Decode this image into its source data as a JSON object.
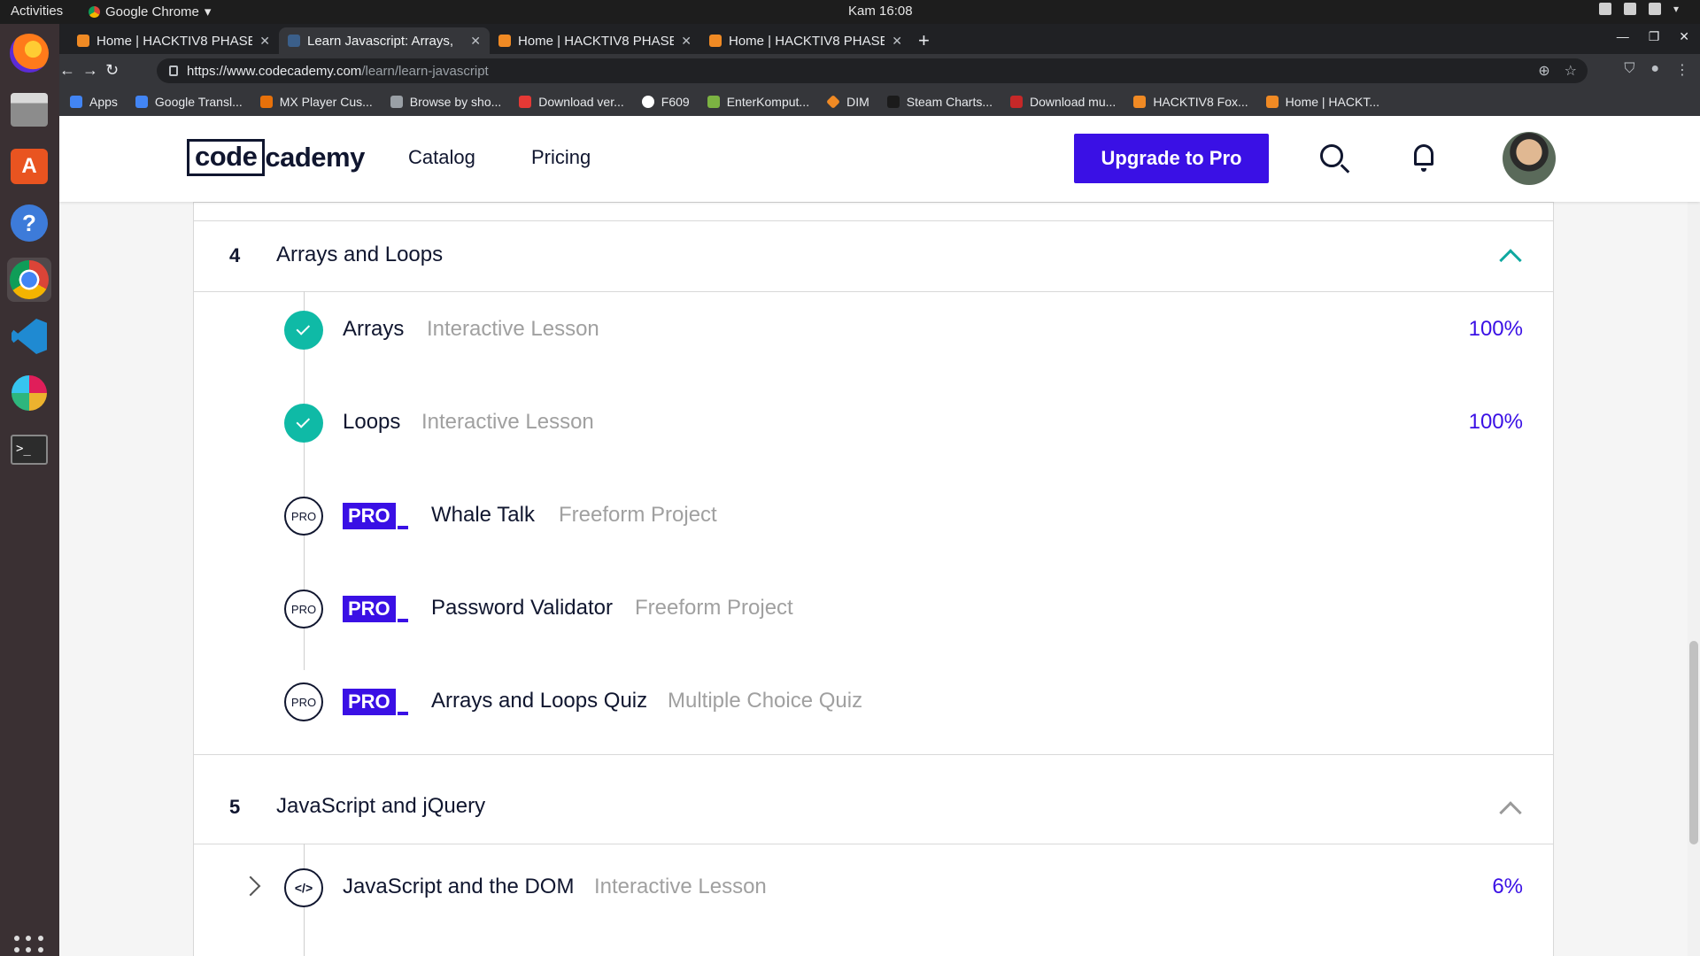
{
  "os": {
    "activities": "Activities",
    "app_name": "Google Chrome",
    "clock": "Kam 16:08"
  },
  "browser": {
    "tabs": [
      {
        "title": "Home | HACKTIV8 PHASE",
        "active": false
      },
      {
        "title": "Learn Javascript: Arrays, ",
        "active": true
      },
      {
        "title": "Home | HACKTIV8 PHASE",
        "active": false
      },
      {
        "title": "Home | HACKTIV8 PHASE",
        "active": false
      }
    ],
    "url_host": "https://www.codecademy.com",
    "url_path": "/learn/learn-javascript",
    "bookmarks": [
      {
        "label": "Apps",
        "color": "#4285f4"
      },
      {
        "label": "Google Transl...",
        "color": "#4285f4"
      },
      {
        "label": "MX Player Cus...",
        "color": "#e8710a"
      },
      {
        "label": "Browse by sho...",
        "color": "#9aa0a6"
      },
      {
        "label": "Download ver...",
        "color": "#e53935"
      },
      {
        "label": "F609",
        "color": "#ffffff"
      },
      {
        "label": "EnterKomput...",
        "color": "#7cb342"
      },
      {
        "label": "DIM",
        "color": "#f08a24"
      },
      {
        "label": "Steam Charts...",
        "color": "#2b2b2b"
      },
      {
        "label": "Download mu...",
        "color": "#c62828"
      },
      {
        "label": "HACKTIV8 Fox...",
        "color": "#f08a24"
      },
      {
        "label": "Home | HACKT...",
        "color": "#f08a24"
      }
    ]
  },
  "site": {
    "logo_left": "code",
    "logo_right": "cademy",
    "nav": [
      "Catalog",
      "Pricing"
    ],
    "upgrade_label": "Upgrade to Pro",
    "brand_color": "#3a10e5",
    "accent_color": "#0fbaa6"
  },
  "modules": [
    {
      "number": "4",
      "title": "Arrays and Loops",
      "expanded": true,
      "lessons": [
        {
          "title": "Arrays",
          "type": "Interactive Lesson",
          "progress": "100%",
          "status": "complete",
          "pro": false
        },
        {
          "title": "Loops",
          "type": "Interactive Lesson",
          "progress": "100%",
          "status": "complete",
          "pro": false
        },
        {
          "title": "Whale Talk",
          "type": "Freeform Project",
          "progress": "",
          "status": "pro",
          "pro": true,
          "badge": "PRO",
          "node_label": "PRO"
        },
        {
          "title": "Password Validator",
          "type": "Freeform Project",
          "progress": "",
          "status": "pro",
          "pro": true,
          "badge": "PRO",
          "node_label": "PRO"
        },
        {
          "title": "Arrays and Loops Quiz",
          "type": "Multiple Choice Quiz",
          "progress": "",
          "status": "pro",
          "pro": true,
          "badge": "PRO",
          "node_label": "PRO"
        }
      ]
    },
    {
      "number": "5",
      "title": "JavaScript and jQuery",
      "expanded": true,
      "lessons": [
        {
          "title": "JavaScript and the DOM",
          "type": "Interactive Lesson",
          "progress": "6%",
          "status": "in-progress",
          "pro": false,
          "node_label": "</>"
        }
      ]
    }
  ]
}
